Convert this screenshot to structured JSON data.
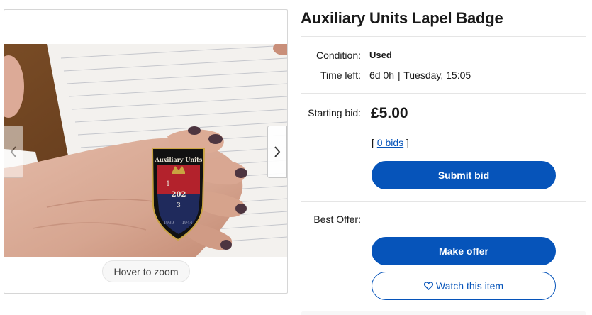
{
  "gallery": {
    "hover_hint": "Hover to zoom",
    "prev_icon": "chevron-left-icon",
    "next_icon": "chevron-right-icon",
    "badge": {
      "top_text": "Auxiliary Units",
      "center_text": "202",
      "left_digit": "1",
      "bottom_digit": "3",
      "years_left": "1939",
      "years_right": "1944",
      "colors": {
        "red": "#b3222c",
        "navy": "#1f2a5c",
        "gold": "#c9a441",
        "black": "#111111"
      }
    }
  },
  "item": {
    "title": "Auxiliary Units Lapel Badge",
    "condition_label": "Condition:",
    "condition_value": "Used",
    "time_left_label": "Time left:",
    "time_left_value": "6d 0h",
    "time_left_separator": "|",
    "end_time": "Tuesday, 15:05",
    "starting_bid_label": "Starting bid:",
    "starting_bid_value": "£5.00",
    "bids_open": "[",
    "bids_link": "0 bids",
    "bids_close": "]",
    "submit_bid_label": "Submit bid",
    "best_offer_label": "Best Offer:",
    "make_offer_label": "Make offer",
    "watch_label": "Watch this item",
    "watch_icon": "heart-icon"
  },
  "colors": {
    "accent": "#0654ba",
    "text": "#191919",
    "divider": "#e5e5e5"
  }
}
